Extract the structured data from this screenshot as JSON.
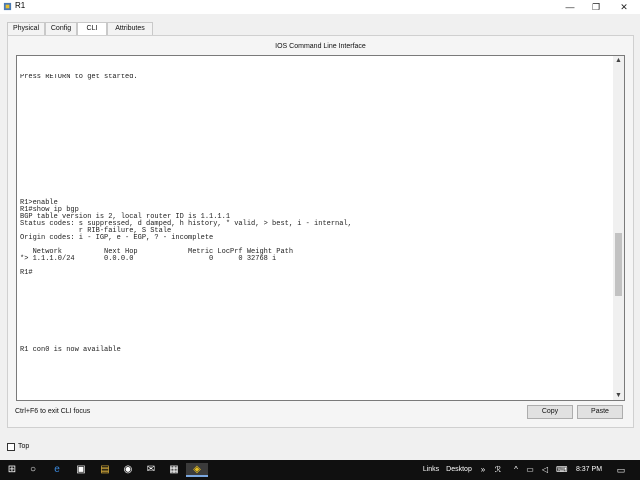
{
  "window": {
    "title": "R1",
    "min_glyph": "—",
    "max_glyph": "❐",
    "close_glyph": "✕"
  },
  "tabs": [
    {
      "label": "Physical"
    },
    {
      "label": "Config"
    },
    {
      "label": "CLI"
    },
    {
      "label": "Attributes"
    }
  ],
  "active_tab": "CLI",
  "panel": {
    "title": "IOS Command Line Interface"
  },
  "terminal": {
    "text": "Press RETURN to get started.\n\n\n\n\n\n\n\n\n\n\n\n\n\n\n\n\n\nR1>enable\nR1#show ip bgp\nBGP table version is 2, local router ID is 1.1.1.1\nStatus codes: s suppressed, d damped, h history, * valid, > best, i - internal,\n              r RIB-failure, S Stale\nOrigin codes: i - IGP, e - EGP, ? - incomplete\n\n   Network          Next Hop            Metric LocPrf Weight Path\n*> 1.1.1.0/24       0.0.0.0                  0      0 32768 i\n\nR1#\n\n\n\n\n\n\n\n\n\n\nR1 con0 is now available",
    "scroll_up_glyph": "▲",
    "scroll_down_glyph": "▼"
  },
  "footer": {
    "hint": "Ctrl+F6 to exit CLI focus",
    "copy_label": "Copy",
    "paste_label": "Paste"
  },
  "top_option": {
    "label": "Top",
    "checked": false
  },
  "taskbar": {
    "start_glyph": "⊞",
    "cortana_glyph": "○",
    "edge_glyph": "e",
    "store_glyph": "▣",
    "files_glyph": "▤",
    "chrome_glyph": "◉",
    "mail_glyph": "✉",
    "app1_glyph": "▦",
    "pt_glyph": "◈",
    "links_label": "Links",
    "desktop_label": "Desktop",
    "chevron_glyph": "»",
    "people_glyph": "ℛ",
    "up_glyph": "^",
    "network_glyph": "▭",
    "volume_glyph": "◁",
    "ime_glyph": "⌨",
    "time": "8:37 PM",
    "notif_glyph": "▭"
  },
  "colors": {
    "taskbar_bg": "#101010",
    "window_bg": "#f0f0f0",
    "terminal_bg": "#ffffff"
  },
  "icons": [
    "app-icon",
    "minimize-icon",
    "maximize-icon",
    "close-icon",
    "scroll-up-icon",
    "scroll-down-icon",
    "windows-start-icon",
    "cortana-icon",
    "edge-icon",
    "store-icon",
    "file-explorer-icon",
    "chrome-icon",
    "mail-icon",
    "packet-tracer-icon",
    "people-icon",
    "chevron-up-icon",
    "network-icon",
    "volume-icon",
    "keyboard-icon",
    "notification-icon"
  ]
}
